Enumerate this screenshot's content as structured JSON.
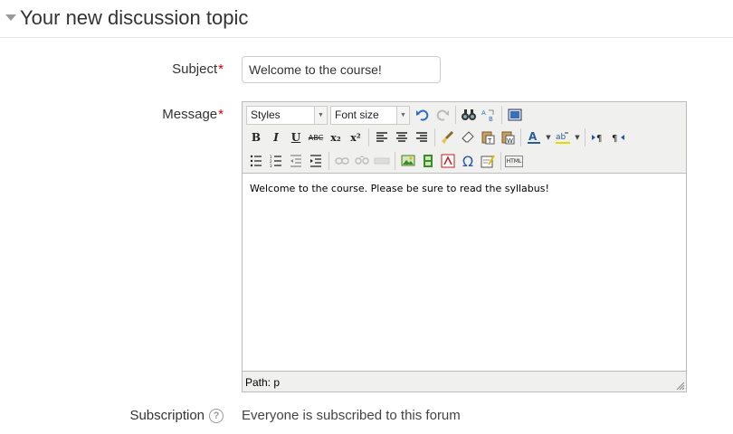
{
  "section": {
    "title": "Your new discussion topic"
  },
  "form": {
    "subject_label": "Subject",
    "subject_value": "Welcome to the course!",
    "message_label": "Message",
    "required_marker": "*",
    "subscription_label": "Subscription",
    "subscription_value": "Everyone is subscribed to this forum"
  },
  "editor": {
    "styles_dropdown": "Styles",
    "fontsize_dropdown": "Font size",
    "content_text": "Welcome to the course. Please be sure to read the syllabus!",
    "path_text": "Path: p",
    "toolbar_row1": [
      "undo-icon",
      "redo-icon",
      "find-icon",
      "find-replace-icon",
      "fullscreen-icon"
    ],
    "toolbar_row2": [
      "bold-icon",
      "italic-icon",
      "underline-icon",
      "strikethrough-icon",
      "subscript-icon",
      "superscript-icon",
      "align-left-icon",
      "align-center-icon",
      "align-right-icon",
      "cleanup-icon",
      "remove-format-icon",
      "paste-text-icon",
      "paste-word-icon",
      "text-color-icon",
      "background-color-icon",
      "ltr-icon",
      "rtl-icon"
    ],
    "toolbar_row3": [
      "bullet-list-icon",
      "numbered-list-icon",
      "outdent-icon",
      "indent-icon",
      "link-icon",
      "unlink-icon",
      "anchor-icon",
      "image-icon",
      "media-icon",
      "equation-icon",
      "special-char-icon",
      "spellcheck-icon",
      "html-icon"
    ],
    "labels": {
      "bold": "B",
      "italic": "I",
      "underline": "U",
      "strikethrough": "ABC",
      "subscript": "x₂",
      "superscript": "x²",
      "html": "HTML",
      "omega": "Ω"
    }
  },
  "colors": {
    "required": "#cc0000",
    "toolbar_bg": "#f0f0ee"
  }
}
